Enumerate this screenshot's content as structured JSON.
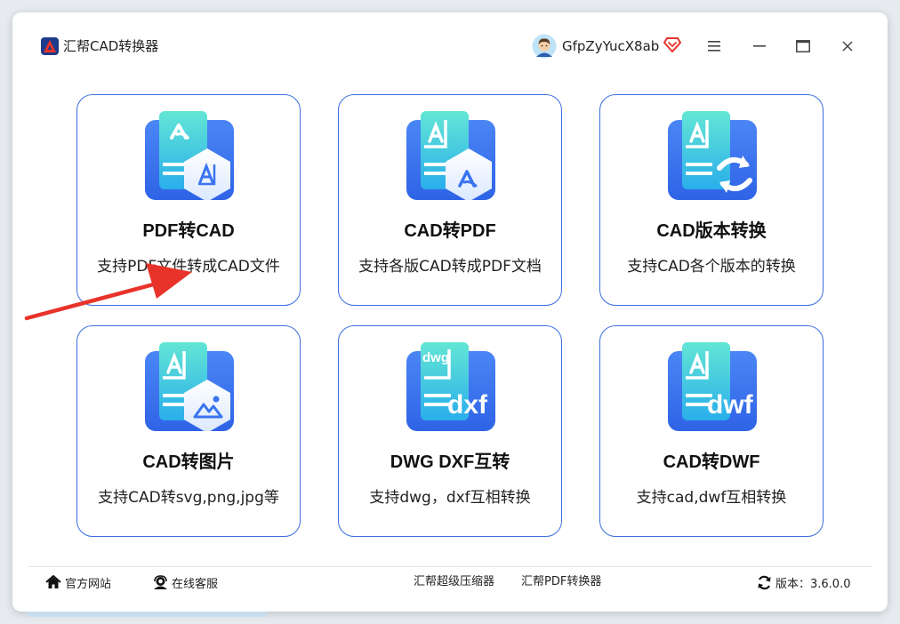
{
  "app": {
    "title": "汇帮CAD转换器"
  },
  "user": {
    "name": "GfpZyYucX8ab"
  },
  "cards": [
    {
      "title": "PDF转CAD",
      "desc": "支持PDF文件转成CAD文件"
    },
    {
      "title": "CAD转PDF",
      "desc": "支持各版CAD转成PDF文档"
    },
    {
      "title": "CAD版本转换",
      "desc": "支持CAD各个版本的转换"
    },
    {
      "title": "CAD转图片",
      "desc": "支持CAD转svg,png,jpg等"
    },
    {
      "title": "DWG DXF互转",
      "desc": "支持dwg，dxf互相转换"
    },
    {
      "title": "CAD转DWF",
      "desc": "支持cad,dwf互相转换"
    }
  ],
  "icons": {
    "dwg": "dwg",
    "dxf": "dxf",
    "dwf": "dwf"
  },
  "footer": {
    "website": "官方网站",
    "support": "在线客服",
    "compressor": "汇帮超级压缩器",
    "pdf_converter": "汇帮PDF转换器",
    "version": "版本：3.6.0.0"
  },
  "colors": {
    "accent": "#3a6fe0",
    "icon_back_top": "#5fe3d5",
    "icon_back_bottom": "#2fb5ea",
    "icon_front": "#3a74f0",
    "annotation_arrow": "#e8332a"
  }
}
